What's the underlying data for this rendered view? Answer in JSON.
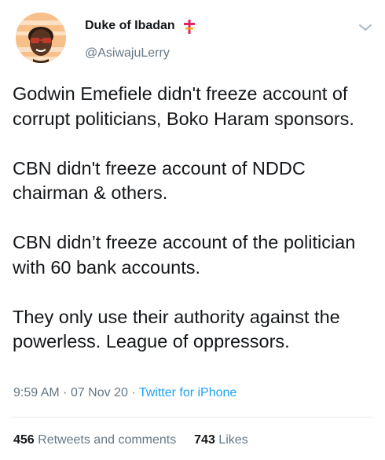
{
  "author": {
    "display_name": "Duke of Ibadan",
    "handle": "@AsiwajuLerry",
    "avatar_icon": "cartoon-face-avatar",
    "badge_icon": "cross-emoji-icon"
  },
  "tweet": {
    "paragraphs": [
      "Godwin Emefiele didn't freeze account of corrupt politicians, Boko Haram sponsors.",
      "CBN didn't freeze account of NDDC chairman & others.",
      "CBN didn’t freeze account of the politician with 60 bank accounts.",
      "They only use their authority against the powerless. League of oppressors."
    ],
    "time": "9:59 AM",
    "separator": "·",
    "date": "07 Nov 20",
    "source": "Twitter for iPhone"
  },
  "stats": {
    "retweets_count": "456",
    "retweets_label": "Retweets and comments",
    "likes_count": "743",
    "likes_label": "Likes"
  },
  "colors": {
    "text": "#14171a",
    "secondary": "#657786",
    "link": "#1da1f2",
    "divider": "#e1e8ed"
  }
}
